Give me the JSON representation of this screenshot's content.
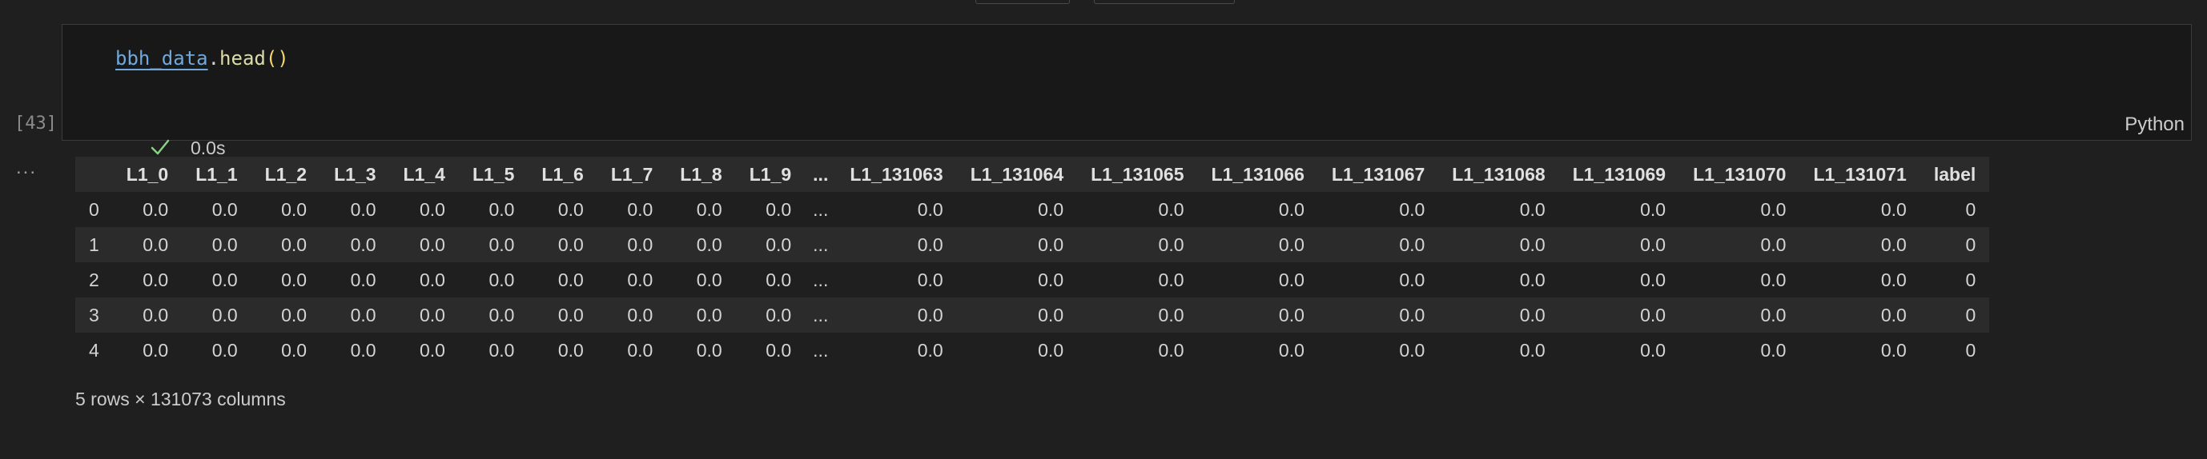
{
  "cell": {
    "code": {
      "var": "bbh_data",
      "dot": ".",
      "fn": "head",
      "parens": "()"
    },
    "execution_count": "[43]",
    "status_icon": "checkmark-icon",
    "duration": "0.0s",
    "language": "Python",
    "output_menu": "..."
  },
  "dataframe": {
    "columns": [
      "",
      "L1_0",
      "L1_1",
      "L1_2",
      "L1_3",
      "L1_4",
      "L1_5",
      "L1_6",
      "L1_7",
      "L1_8",
      "L1_9",
      "...",
      "L1_131063",
      "L1_131064",
      "L1_131065",
      "L1_131066",
      "L1_131067",
      "L1_131068",
      "L1_131069",
      "L1_131070",
      "L1_131071",
      "label"
    ],
    "rows": [
      [
        "0",
        "0.0",
        "0.0",
        "0.0",
        "0.0",
        "0.0",
        "0.0",
        "0.0",
        "0.0",
        "0.0",
        "0.0",
        "...",
        "0.0",
        "0.0",
        "0.0",
        "0.0",
        "0.0",
        "0.0",
        "0.0",
        "0.0",
        "0.0",
        "0"
      ],
      [
        "1",
        "0.0",
        "0.0",
        "0.0",
        "0.0",
        "0.0",
        "0.0",
        "0.0",
        "0.0",
        "0.0",
        "0.0",
        "...",
        "0.0",
        "0.0",
        "0.0",
        "0.0",
        "0.0",
        "0.0",
        "0.0",
        "0.0",
        "0.0",
        "0"
      ],
      [
        "2",
        "0.0",
        "0.0",
        "0.0",
        "0.0",
        "0.0",
        "0.0",
        "0.0",
        "0.0",
        "0.0",
        "0.0",
        "...",
        "0.0",
        "0.0",
        "0.0",
        "0.0",
        "0.0",
        "0.0",
        "0.0",
        "0.0",
        "0.0",
        "0"
      ],
      [
        "3",
        "0.0",
        "0.0",
        "0.0",
        "0.0",
        "0.0",
        "0.0",
        "0.0",
        "0.0",
        "0.0",
        "0.0",
        "...",
        "0.0",
        "0.0",
        "0.0",
        "0.0",
        "0.0",
        "0.0",
        "0.0",
        "0.0",
        "0.0",
        "0"
      ],
      [
        "4",
        "0.0",
        "0.0",
        "0.0",
        "0.0",
        "0.0",
        "0.0",
        "0.0",
        "0.0",
        "0.0",
        "0.0",
        "...",
        "0.0",
        "0.0",
        "0.0",
        "0.0",
        "0.0",
        "0.0",
        "0.0",
        "0.0",
        "0.0",
        "0"
      ]
    ],
    "shape_note": "5 rows × 131073 columns"
  },
  "colors": {
    "background": "#1f1f1f",
    "cell_background": "#181818",
    "success": "#89d185"
  }
}
